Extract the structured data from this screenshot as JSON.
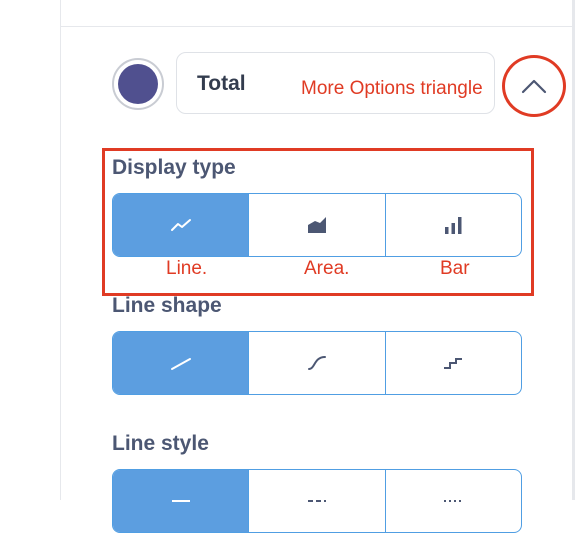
{
  "series": {
    "name": "Total",
    "color": "#50508f"
  },
  "annotations": {
    "more_options": "More Options triangle",
    "line": "Line.",
    "area": "Area.",
    "bar": "Bar"
  },
  "display_type": {
    "title": "Display type",
    "options": [
      {
        "icon": "line-chart-icon",
        "selected": true
      },
      {
        "icon": "area-chart-icon",
        "selected": false
      },
      {
        "icon": "bar-chart-icon",
        "selected": false
      }
    ]
  },
  "line_shape": {
    "title": "Line shape",
    "options": [
      {
        "icon": "linear-shape-icon",
        "selected": true
      },
      {
        "icon": "curved-shape-icon",
        "selected": false
      },
      {
        "icon": "step-shape-icon",
        "selected": false
      }
    ]
  },
  "line_style": {
    "title": "Line style",
    "options": [
      {
        "icon": "solid-line-icon",
        "selected": true
      },
      {
        "icon": "dashed-line-icon",
        "selected": false
      },
      {
        "icon": "dotted-line-icon",
        "selected": false
      }
    ]
  },
  "colors": {
    "accent": "#509ee3",
    "selected_fill": "#5c9ee0",
    "annotation_red": "#e03b24",
    "text": "#4c5773"
  }
}
